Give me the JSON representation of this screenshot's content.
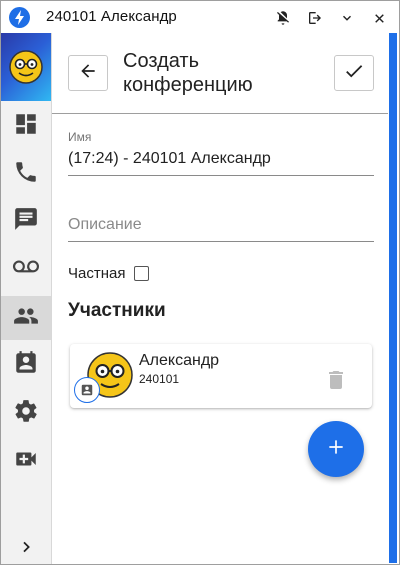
{
  "window": {
    "title": "240101 Александр",
    "app_icon": "bolt-icon",
    "controls": [
      "mute-notifications-icon",
      "logout-icon",
      "minimize-icon",
      "close-icon"
    ]
  },
  "sidebar": {
    "items": [
      {
        "name": "dashboard",
        "icon": "dashboard-icon",
        "active": false
      },
      {
        "name": "calls",
        "icon": "phone-icon",
        "active": false
      },
      {
        "name": "chats",
        "icon": "chat-icon",
        "active": false
      },
      {
        "name": "voicemail",
        "icon": "voicemail-icon",
        "active": false
      },
      {
        "name": "contacts",
        "icon": "people-icon",
        "active": true
      },
      {
        "name": "meetings",
        "icon": "contact-calendar-icon",
        "active": false
      },
      {
        "name": "settings",
        "icon": "gear-icon",
        "active": false
      },
      {
        "name": "video",
        "icon": "video-add-icon",
        "active": false
      }
    ],
    "expand_icon": "chevron-right-icon"
  },
  "header": {
    "title": "Создать конференцию"
  },
  "form": {
    "name_label": "Имя",
    "name_value": "(17:24) - 240101 Александр",
    "description_placeholder": "Описание",
    "private_label": "Частная",
    "private_checked": false
  },
  "participants": {
    "title": "Участники",
    "items": [
      {
        "name": "Александр",
        "extension": "240101"
      }
    ]
  },
  "colors": {
    "accent": "#1e6fe8",
    "avatar_face": "#f5c518"
  }
}
